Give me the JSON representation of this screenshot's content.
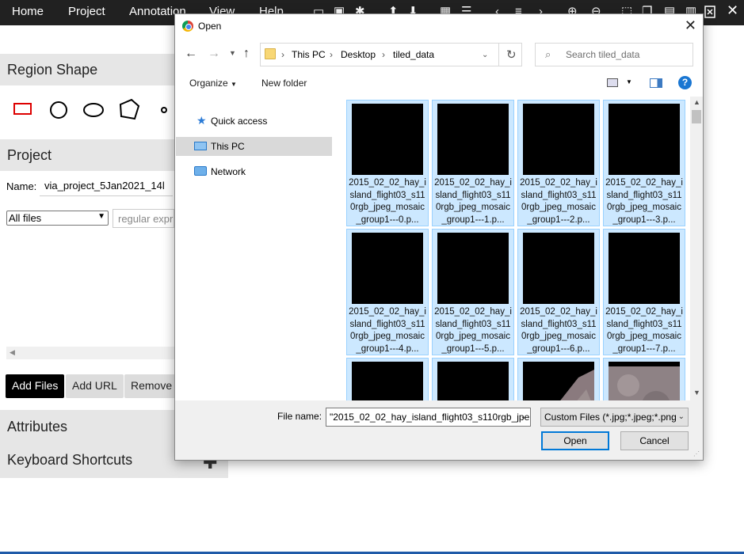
{
  "app": {
    "menu": [
      "Home",
      "Project",
      "Annotation",
      "View",
      "Help"
    ],
    "toolbar_icons": [
      "folder-open-icon",
      "save-icon",
      "settings-icon",
      "arrow-up-icon",
      "arrow-down-icon",
      "grid-icon",
      "list-icon",
      "prev-icon",
      "list-alt-icon",
      "next-icon",
      "zoom-in-icon",
      "zoom-out-icon",
      "select-all-icon",
      "copy-icon",
      "paste-icon",
      "paste-special-icon",
      "delete-icon",
      "close-icon"
    ],
    "region_shape": {
      "title": "Region Shape"
    },
    "project": {
      "title": "Project",
      "name_label": "Name:",
      "name_value": "via_project_5Jan2021_14l",
      "filter_select": "All files",
      "regex_placeholder": "regular expr",
      "add_files": "Add Files",
      "add_url": "Add URL",
      "remove": "Remove"
    },
    "attributes_title": "Attributes",
    "shortcuts_title": "Keyboard Shortcuts"
  },
  "dialog": {
    "title": "Open",
    "breadcrumb": [
      "This PC",
      "Desktop",
      "tiled_data"
    ],
    "search_placeholder": "Search tiled_data",
    "organize": "Organize",
    "new_folder": "New folder",
    "nav": [
      "Quick access",
      "This PC",
      "Network"
    ],
    "files": [
      "2015_02_02_hay_island_flight03_s110rgb_jpeg_mosaic_group1---0.p...",
      "2015_02_02_hay_island_flight03_s110rgb_jpeg_mosaic_group1---1.p...",
      "2015_02_02_hay_island_flight03_s110rgb_jpeg_mosaic_group1---2.p...",
      "2015_02_02_hay_island_flight03_s110rgb_jpeg_mosaic_group1---3.p...",
      "2015_02_02_hay_island_flight03_s110rgb_jpeg_mosaic_group1---4.p...",
      "2015_02_02_hay_island_flight03_s110rgb_jpeg_mosaic_group1---5.p...",
      "2015_02_02_hay_island_flight03_s110rgb_jpeg_mosaic_group1---6.p...",
      "2015_02_02_hay_island_flight03_s110rgb_jpeg_mosaic_group1---7.p..."
    ],
    "file_name_label": "File name:",
    "file_name_value": "\"2015_02_02_hay_island_flight03_s110rgb_jpe",
    "file_type": "Custom Files (*.jpg;*.jpeg;*.png",
    "open": "Open",
    "cancel": "Cancel"
  }
}
